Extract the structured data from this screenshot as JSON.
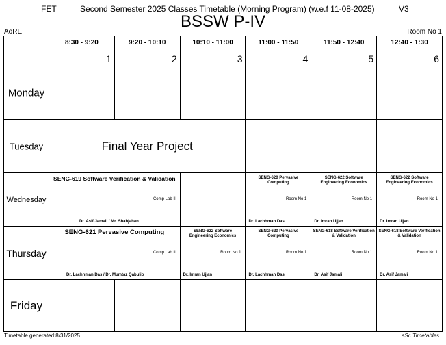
{
  "header": {
    "fet": "FET",
    "semester": "Second Semester 2025 Classes Timetable (Morning Program) (w.e.f 11-08-2025)",
    "version": "V3",
    "title": "BSSW P-IV",
    "left_label": "AoRE",
    "room": "Room No 1"
  },
  "periods": [
    {
      "time": "8:30 - 9:20",
      "num": "1"
    },
    {
      "time": "9:20 - 10:10",
      "num": "2"
    },
    {
      "time": "10:10 - 11:00",
      "num": "3"
    },
    {
      "time": "11:00 - 11:50",
      "num": "4"
    },
    {
      "time": "11:50 - 12:40",
      "num": "5"
    },
    {
      "time": "12:40 - 1:30",
      "num": "6"
    }
  ],
  "days": [
    "Monday",
    "Tuesday",
    "Wednesday",
    "Thursday",
    "Friday"
  ],
  "tuesday": {
    "project": "Final Year Project"
  },
  "wednesday": {
    "a": {
      "title": "SENG-619  Software Verification & Validation",
      "room": "Comp Lab II",
      "teacher": "Dr. Asif Jamali / Mr. Shahjahan"
    },
    "b": {
      "title": "SENG-620  Pervasive Computing",
      "room": "Room No 1",
      "teacher": "Dr. Lachhman Das"
    },
    "c": {
      "title": "SENG-622  Software Engineering Economics",
      "room": "Room No 1",
      "teacher": "Dr. Imran Ujjan"
    },
    "d": {
      "title": "SENG-622  Software Engineering Economics",
      "room": "Room No 1",
      "teacher": "Dr. Imran Ujjan"
    }
  },
  "thursday": {
    "a": {
      "title": "SENG-621  Pervasive Computing",
      "room": "Comp Lab II",
      "teacher": "Dr. Lachhman Das / Dr. Mumtaz Qabulio"
    },
    "b": {
      "title": "SENG-622  Software Engineering Economics",
      "room": "Room No 1",
      "teacher": "Dr. Imran Ujjan"
    },
    "c": {
      "title": "SENG-620  Pervasive Computing",
      "room": "Room No 1",
      "teacher": "Dr. Lachhman Das"
    },
    "d": {
      "title": "SENG-618  Software Verification & Validation",
      "room": "Room No 1",
      "teacher": "Dr. Asif Jamali"
    },
    "e": {
      "title": "SENG-618  Software Verification & Validation",
      "room": "Room No 1",
      "teacher": "Dr. Asif Jamali"
    }
  },
  "footer": {
    "generated": "Timetable generated:8/31/2025",
    "brand": "aSc Timetables"
  }
}
